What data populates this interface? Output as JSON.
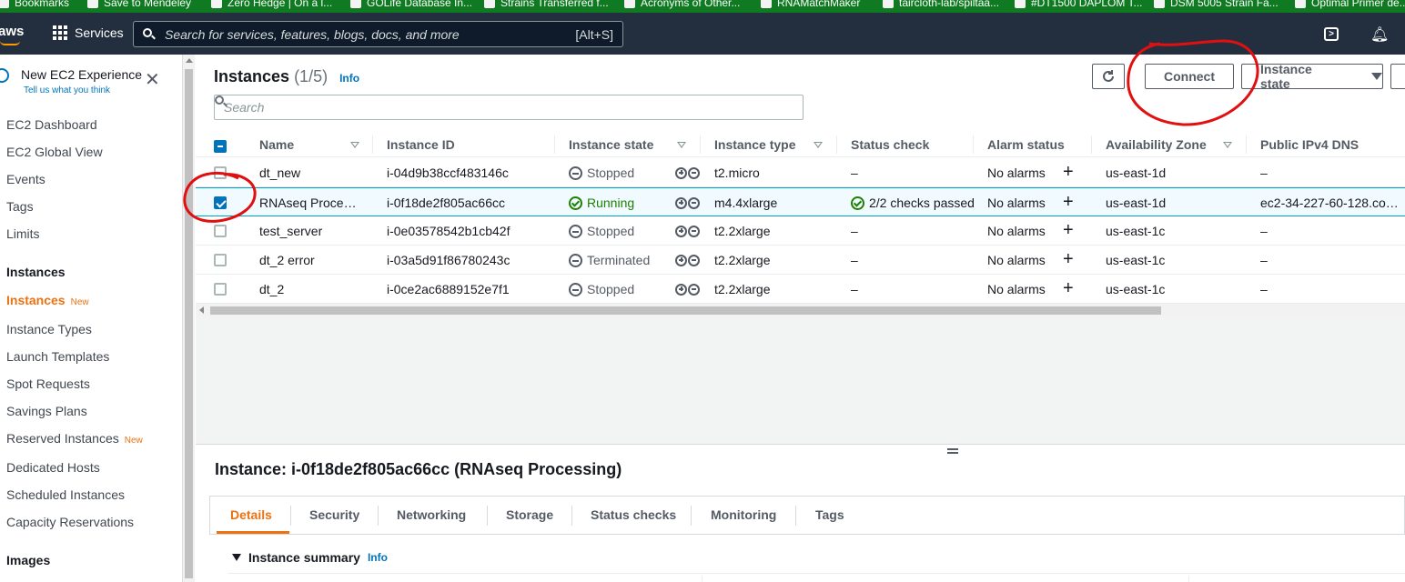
{
  "bookmarks": [
    "Bookmarks",
    "Save to Mendeley",
    "Zero Hedge | On a l...",
    "GOLife Database In...",
    "Strains Transferred f...",
    "Acronyms of Other...",
    "RNAMatchMaker",
    "taircloth-lab/spiltaa...",
    "#DT1500 DAPLOM T...",
    "DSM 5005 Strain Fa...",
    "Optimal Primer de..."
  ],
  "topnav": {
    "logo": "aws",
    "services_label": "Services",
    "search_placeholder": "Search for services, features, blogs, docs, and more",
    "search_shortcut": "[Alt+S]",
    "icons": [
      "grid-icon",
      "search-icon",
      "cloudshell-icon",
      "bell-icon"
    ]
  },
  "sidebar": {
    "experience_title": "New EC2 Experience",
    "experience_sub": "Tell us what you think",
    "items": [
      {
        "label": "EC2 Dashboard",
        "kind": "item"
      },
      {
        "label": "EC2 Global View",
        "kind": "item"
      },
      {
        "label": "Events",
        "kind": "item"
      },
      {
        "label": "Tags",
        "kind": "item"
      },
      {
        "label": "Limits",
        "kind": "item"
      },
      {
        "label": "Instances",
        "kind": "section"
      },
      {
        "label": "Instances",
        "kind": "active",
        "badge": "New"
      },
      {
        "label": "Instance Types",
        "kind": "item"
      },
      {
        "label": "Launch Templates",
        "kind": "item"
      },
      {
        "label": "Spot Requests",
        "kind": "item"
      },
      {
        "label": "Savings Plans",
        "kind": "item"
      },
      {
        "label": "Reserved Instances",
        "kind": "item",
        "badge": "New"
      },
      {
        "label": "Dedicated Hosts",
        "kind": "item"
      },
      {
        "label": "Scheduled Instances",
        "kind": "item"
      },
      {
        "label": "Capacity Reservations",
        "kind": "item"
      },
      {
        "label": "Images",
        "kind": "section"
      }
    ]
  },
  "header": {
    "title": "Instances",
    "count": "(1/5)",
    "info": "Info",
    "connect_label": "Connect",
    "state_label": "Instance state",
    "search_placeholder": "Search"
  },
  "table": {
    "columns": [
      "Name",
      "Instance ID",
      "Instance state",
      "Instance type",
      "Status check",
      "Alarm status",
      "Availability Zone",
      "Public IPv4 DNS"
    ],
    "rows": [
      {
        "name": "dt_new",
        "id": "i-04d9b38ccf483146c",
        "state": "Stopped",
        "state_kind": "stopped",
        "type": "t2.micro",
        "status": "–",
        "alarm": "No alarms",
        "zone": "us-east-1d",
        "dns": "–",
        "selected": false
      },
      {
        "name": "RNAseq Proce…",
        "id": "i-0f18de2f805ac66cc",
        "state": "Running",
        "state_kind": "running",
        "type": "m4.4xlarge",
        "status": "2/2 checks passed",
        "alarm": "No alarms",
        "zone": "us-east-1d",
        "dns": "ec2-34-227-60-128.co…",
        "selected": true
      },
      {
        "name": "test_server",
        "id": "i-0e03578542b1cb42f",
        "state": "Stopped",
        "state_kind": "stopped",
        "type": "t2.2xlarge",
        "status": "–",
        "alarm": "No alarms",
        "zone": "us-east-1c",
        "dns": "–",
        "selected": false
      },
      {
        "name": "dt_2 error",
        "id": "i-03a5d91f86780243c",
        "state": "Terminated",
        "state_kind": "terminated",
        "type": "t2.2xlarge",
        "status": "–",
        "alarm": "No alarms",
        "zone": "us-east-1c",
        "dns": "–",
        "selected": false
      },
      {
        "name": "dt_2",
        "id": "i-0ce2ac6889152e7f1",
        "state": "Stopped",
        "state_kind": "stopped",
        "type": "t2.2xlarge",
        "status": "–",
        "alarm": "No alarms",
        "zone": "us-east-1c",
        "dns": "–",
        "selected": false
      }
    ]
  },
  "details": {
    "title": "Instance: i-0f18de2f805ac66cc (RNAseq Processing)",
    "tabs": [
      "Details",
      "Security",
      "Networking",
      "Storage",
      "Status checks",
      "Monitoring",
      "Tags"
    ],
    "active_tab": "Details",
    "summary_label": "Instance summary",
    "summary_info": "Info"
  },
  "colors": {
    "nav_bg": "#232f3e",
    "accent_orange": "#ec7211",
    "link_blue": "#0073bb",
    "running_green": "#1d8102",
    "annotation_red": "#e01010"
  }
}
